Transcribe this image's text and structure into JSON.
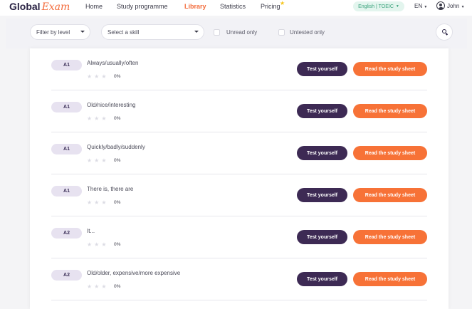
{
  "header": {
    "logo_main": "Global",
    "logo_accent": "Exam",
    "nav": [
      {
        "label": "Home",
        "active": false
      },
      {
        "label": "Study programme",
        "active": false
      },
      {
        "label": "Library",
        "active": true
      },
      {
        "label": "Statistics",
        "active": false
      },
      {
        "label": "Pricing",
        "active": false
      }
    ],
    "pricing_badge_icon": "star-icon",
    "exam_selector": "English | TOEIC",
    "language": "EN",
    "user_name": "John"
  },
  "filters": {
    "level_label": "Filter by level",
    "skill_placeholder": "Select a skill",
    "unread_label": "Unread only",
    "untested_label": "Untested only",
    "search_icon": "search-icon"
  },
  "lessons": [
    {
      "level": "A1",
      "title": "Always/usually/often",
      "rating": 0,
      "progress": "0%",
      "test_label": "Test yourself",
      "read_label": "Read the study sheet"
    },
    {
      "level": "A1",
      "title": "Old/nice/interesting",
      "rating": 0,
      "progress": "0%",
      "test_label": "Test yourself",
      "read_label": "Read the study sheet"
    },
    {
      "level": "A1",
      "title": "Quickly/badly/suddenly",
      "rating": 0,
      "progress": "0%",
      "test_label": "Test yourself",
      "read_label": "Read the study sheet"
    },
    {
      "level": "A1",
      "title": "There is, there are",
      "rating": 0,
      "progress": "0%",
      "test_label": "Test yourself",
      "read_label": "Read the study sheet"
    },
    {
      "level": "A2",
      "title": "It...",
      "rating": 0,
      "progress": "0%",
      "test_label": "Test yourself",
      "read_label": "Read the study sheet"
    },
    {
      "level": "A2",
      "title": "Old/older, expensive/more expensive",
      "rating": 0,
      "progress": "0%",
      "test_label": "Test yourself",
      "read_label": "Read the study sheet"
    }
  ],
  "colors": {
    "brand_dark": "#3d2a54",
    "brand_orange": "#f77237",
    "exam_pill": "#e3f5ee"
  }
}
